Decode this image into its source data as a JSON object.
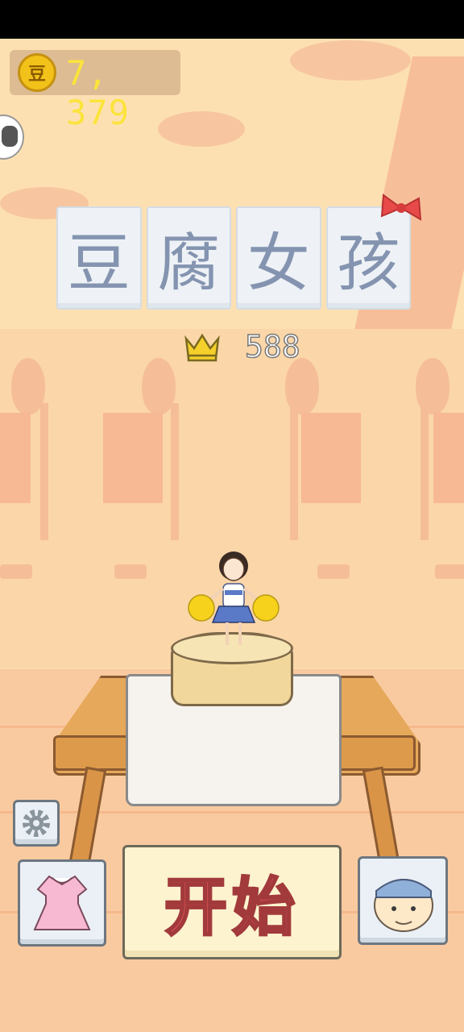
{
  "hud": {
    "coin_icon_char": "豆",
    "coins": "7, 379"
  },
  "title": {
    "chars": [
      "豆",
      "腐",
      "女",
      "孩"
    ]
  },
  "best_score": "588",
  "start_button": {
    "label": "开始"
  },
  "icons": {
    "coin": "coin-icon",
    "crown": "crown-icon",
    "gear": "gear-icon",
    "dress": "dress-icon",
    "character": "uncle-face-icon"
  },
  "colors": {
    "background": "#fbdcae",
    "coin_text": "#fbe43a",
    "title_text": "#8494b0",
    "start_text": "#ee5b5e"
  }
}
